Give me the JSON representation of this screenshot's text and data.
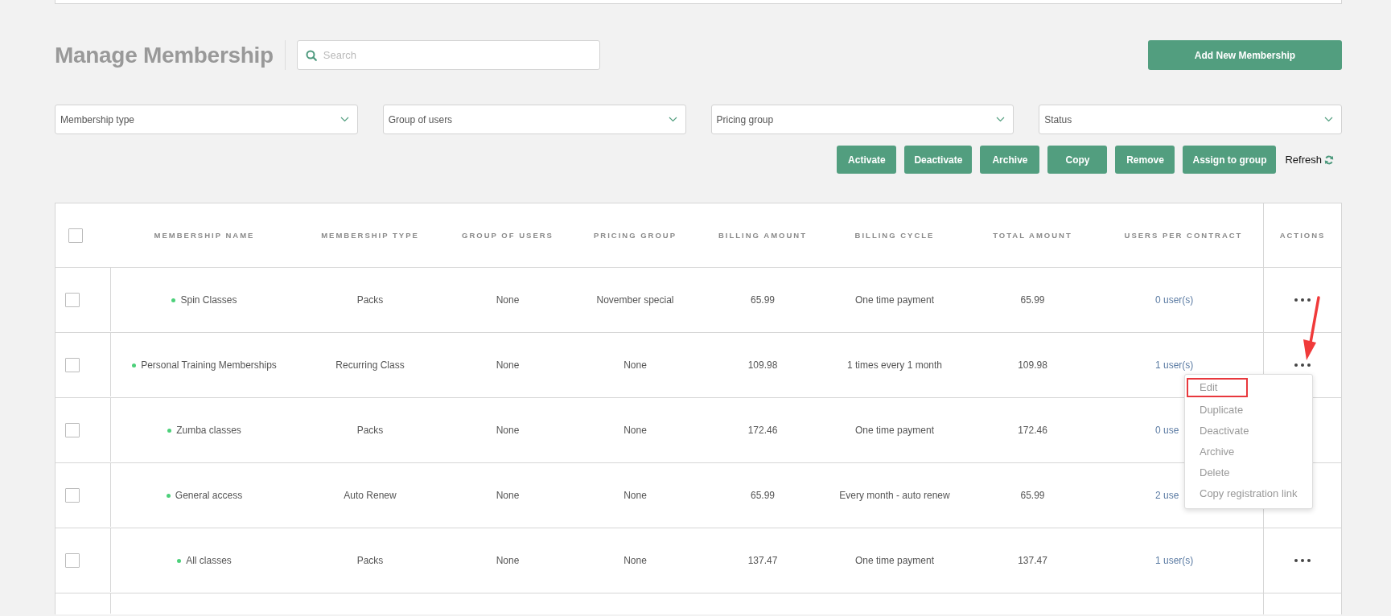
{
  "title": "Manage Membership",
  "search": {
    "placeholder": "Search"
  },
  "add_button": "Add New Membership",
  "filters": [
    {
      "label": "Membership type"
    },
    {
      "label": "Group of users"
    },
    {
      "label": "Pricing group"
    },
    {
      "label": "Status"
    }
  ],
  "bulk_actions": [
    "Activate",
    "Deactivate",
    "Archive",
    "Copy",
    "Remove",
    "Assign to group"
  ],
  "refresh": "Refresh",
  "table": {
    "select_all_checked": false,
    "columns": [
      "MEMBERSHIP NAME",
      "MEMBERSHIP TYPE",
      "GROUP OF USERS",
      "PRICING GROUP",
      "BILLING AMOUNT",
      "BILLING CYCLE",
      "TOTAL AMOUNT",
      "USERS PER CONTRACT",
      "ACTIONS"
    ],
    "rows": [
      {
        "checked": false,
        "active": true,
        "cells": [
          "Spin Classes",
          "Packs",
          "None",
          "November special",
          "65.99",
          "One time payment",
          "65.99",
          "0 user(s)"
        ],
        "more_button": true
      },
      {
        "checked": false,
        "active": true,
        "cells": [
          "Personal Training Memberships",
          "Recurring Class",
          "None",
          "None",
          "109.98",
          "1 times every 1 month",
          "109.98",
          "1 user(s)"
        ],
        "more_button": true
      },
      {
        "checked": false,
        "active": true,
        "cells": [
          "Zumba classes",
          "Packs",
          "None",
          "None",
          "172.46",
          "One time payment",
          "172.46",
          "0 use"
        ],
        "more_button": false
      },
      {
        "checked": false,
        "active": true,
        "cells": [
          "General access",
          "Auto Renew",
          "None",
          "None",
          "65.99",
          "Every month - auto renew",
          "65.99",
          "2 use"
        ],
        "more_button": false
      },
      {
        "checked": false,
        "active": true,
        "cells": [
          "All classes",
          "Packs",
          "None",
          "None",
          "137.47",
          "One time payment",
          "137.47",
          "1 user(s)"
        ],
        "more_button": true
      }
    ]
  },
  "menu": {
    "items": [
      {
        "label": "Edit",
        "highlighted": true
      },
      {
        "label": "Duplicate",
        "highlighted": false
      },
      {
        "label": "Deactivate",
        "highlighted": false
      },
      {
        "label": "Archive",
        "highlighted": false
      },
      {
        "label": "Delete",
        "highlighted": false
      },
      {
        "label": "Copy registration link",
        "highlighted": false
      }
    ]
  }
}
